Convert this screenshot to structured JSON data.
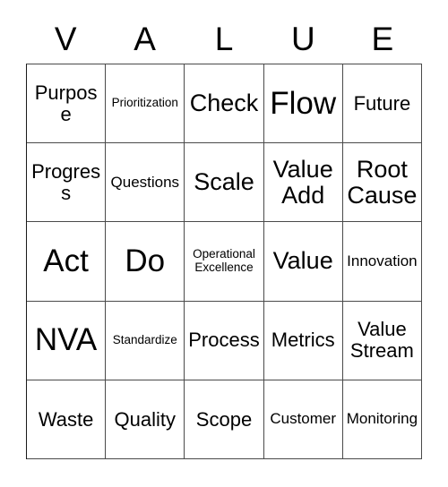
{
  "card": {
    "title_letters": [
      "V",
      "A",
      "L",
      "U",
      "E"
    ],
    "columns": 5,
    "rows": 5,
    "border_color": "#4a4a4a",
    "text_color": "#000000",
    "background_color": "#ffffff",
    "cells": [
      {
        "text": "Purpose",
        "size": "md"
      },
      {
        "text": "Prioritization",
        "size": "xs"
      },
      {
        "text": "Check",
        "size": "lg"
      },
      {
        "text": "Flow",
        "size": "xl"
      },
      {
        "text": "Future",
        "size": "md"
      },
      {
        "text": "Progress",
        "size": "md"
      },
      {
        "text": "Questions",
        "size": "sm"
      },
      {
        "text": "Scale",
        "size": "lg"
      },
      {
        "text": "Value Add",
        "size": "lg"
      },
      {
        "text": "Root Cause",
        "size": "lg"
      },
      {
        "text": "Act",
        "size": "xl"
      },
      {
        "text": "Do",
        "size": "xl"
      },
      {
        "text": "Operational Excellence",
        "size": "xs"
      },
      {
        "text": "Value",
        "size": "lg"
      },
      {
        "text": "Innovation",
        "size": "sm"
      },
      {
        "text": "NVA",
        "size": "xl"
      },
      {
        "text": "Standardize",
        "size": "xs"
      },
      {
        "text": "Process",
        "size": "md"
      },
      {
        "text": "Metrics",
        "size": "md"
      },
      {
        "text": "Value Stream",
        "size": "md"
      },
      {
        "text": "Waste",
        "size": "md"
      },
      {
        "text": "Quality",
        "size": "md"
      },
      {
        "text": "Scope",
        "size": "md"
      },
      {
        "text": "Customer",
        "size": "sm"
      },
      {
        "text": "Monitoring",
        "size": "sm"
      }
    ]
  }
}
